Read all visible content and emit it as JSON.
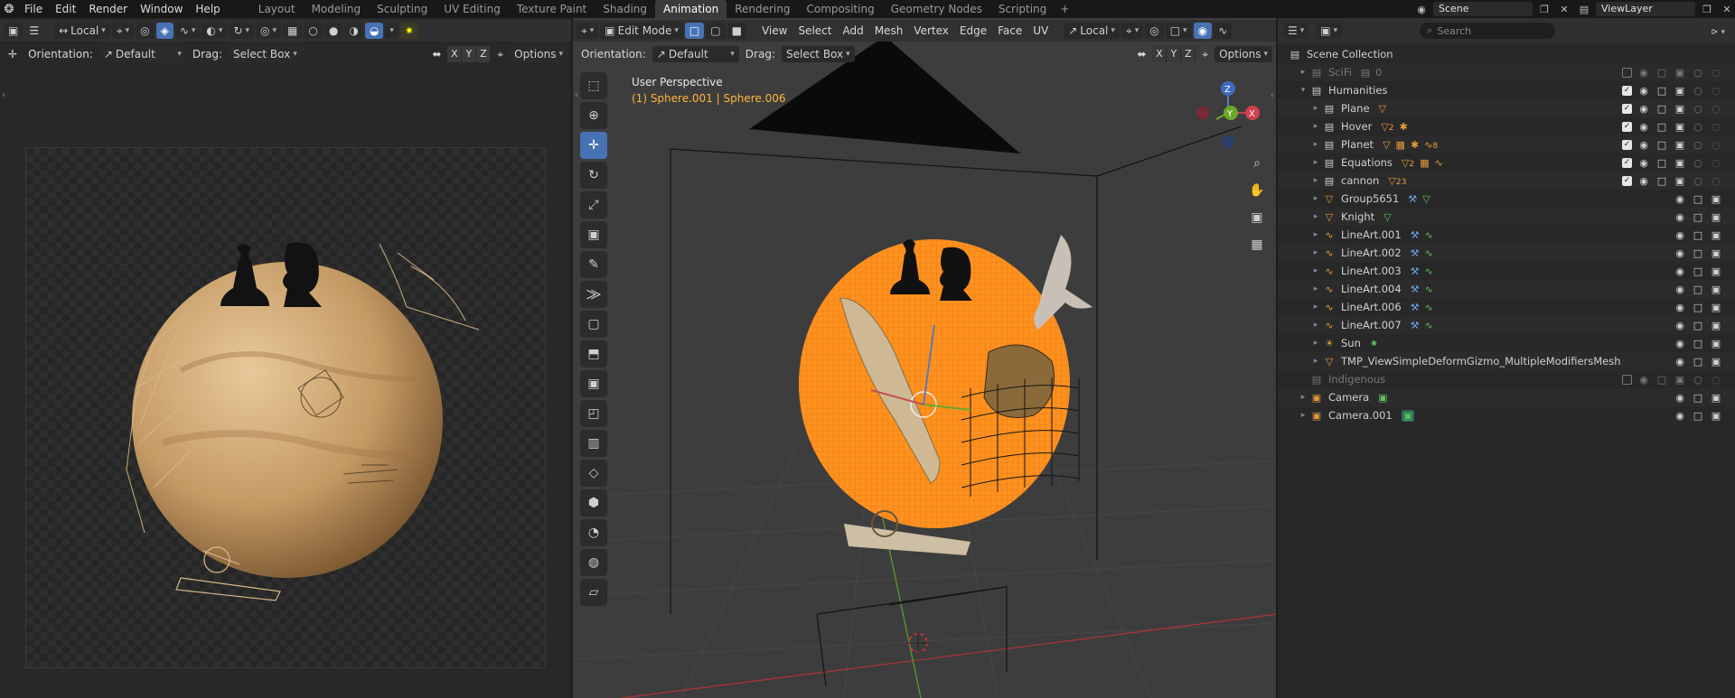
{
  "menubar": {
    "items": [
      "File",
      "Edit",
      "Render",
      "Window",
      "Help"
    ],
    "workspaces": [
      "Layout",
      "Modeling",
      "Sculpting",
      "UV Editing",
      "Texture Paint",
      "Shading",
      "Animation",
      "Rendering",
      "Compositing",
      "Geometry Nodes",
      "Scripting"
    ],
    "active_workspace": "Animation",
    "scene": "Scene",
    "view_layer": "ViewLayer"
  },
  "left_editor": {
    "transform_pivot": "Local",
    "orientation_label": "Orientation:",
    "orientation_value": "Default",
    "drag_label": "Drag:",
    "drag_value": "Select Box",
    "axes": [
      "X",
      "Y",
      "Z"
    ],
    "options_label": "Options"
  },
  "viewport": {
    "mode": "Edit Mode",
    "menus": [
      "View",
      "Select",
      "Add",
      "Mesh",
      "Vertex",
      "Edge",
      "Face",
      "UV"
    ],
    "transform_orientation": "Local",
    "orientation_label": "Orientation:",
    "orientation_value": "Default",
    "drag_label": "Drag:",
    "drag_value": "Select Box",
    "axes": [
      "X",
      "Y",
      "Z"
    ],
    "options_label": "Options",
    "view_name": "User Perspective",
    "selection_info": "(1) Sphere.001 | Sphere.006",
    "gizmo": {
      "z": "Z",
      "y": "Y",
      "x": "X"
    }
  },
  "outliner": {
    "search_placeholder": "Search",
    "root": "Scene Collection",
    "rows": [
      {
        "label": "SciFi",
        "indent": 1,
        "type": "collection",
        "dim": true,
        "extra": "0"
      },
      {
        "label": "Humanities",
        "indent": 1,
        "type": "collection",
        "expanded": true
      },
      {
        "label": "Plane",
        "indent": 2,
        "type": "collection"
      },
      {
        "label": "Hover",
        "indent": 2,
        "type": "collection",
        "extra": "2"
      },
      {
        "label": "Planet",
        "indent": 2,
        "type": "collection",
        "extra": "8"
      },
      {
        "label": "Equations",
        "indent": 2,
        "type": "collection",
        "extra": "2"
      },
      {
        "label": "cannon",
        "indent": 2,
        "type": "collection",
        "extra": "23"
      },
      {
        "label": "Group5651",
        "indent": 2,
        "type": "object"
      },
      {
        "label": "Knight",
        "indent": 2,
        "type": "object"
      },
      {
        "label": "LineArt.001",
        "indent": 2,
        "type": "lineart"
      },
      {
        "label": "LineArt.002",
        "indent": 2,
        "type": "lineart"
      },
      {
        "label": "LineArt.003",
        "indent": 2,
        "type": "lineart"
      },
      {
        "label": "LineArt.004",
        "indent": 2,
        "type": "lineart"
      },
      {
        "label": "LineArt.006",
        "indent": 2,
        "type": "lineart"
      },
      {
        "label": "LineArt.007",
        "indent": 2,
        "type": "lineart"
      },
      {
        "label": "Sun",
        "indent": 2,
        "type": "light"
      },
      {
        "label": "TMP_ViewSimpleDeformGizmo_MultipleModifiersMesh",
        "indent": 2,
        "type": "object"
      },
      {
        "label": "Indigenous",
        "indent": 1,
        "type": "collection",
        "dim": true
      },
      {
        "label": "Camera",
        "indent": 0,
        "type": "camera"
      },
      {
        "label": "Camera.001",
        "indent": 0,
        "type": "camera"
      }
    ]
  },
  "colors": {
    "accent": "#4772b3",
    "selection": "#ff8c00",
    "object": "#e49a3a"
  }
}
